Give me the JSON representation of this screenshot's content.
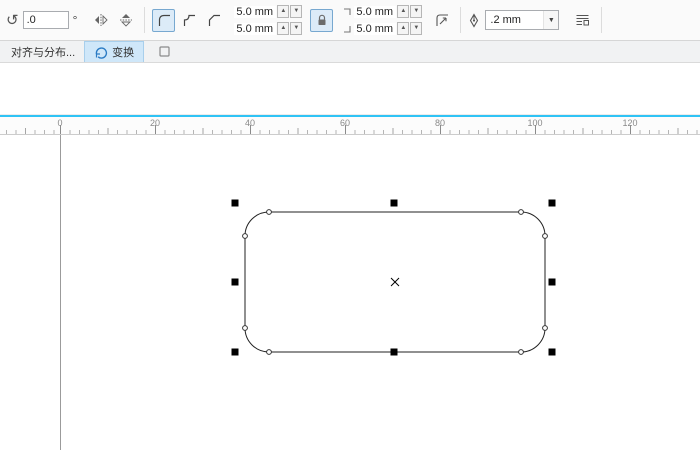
{
  "property_bar": {
    "rotation": {
      "icon_glyph": "↺",
      "value": ".0",
      "degree_symbol": "°"
    },
    "corner_radius": {
      "top_left": "5.0 mm",
      "bottom_left": "5.0 mm",
      "top_right": "5.0 mm",
      "bottom_right": "5.0 mm"
    },
    "outline_width": ".2 mm",
    "glyphs": {
      "spin_up": "▲",
      "spin_down": "▼",
      "dropdown_arrow": "▼"
    }
  },
  "docker_tabs": {
    "align_distribute": "对齐与分布...",
    "transform": "变换"
  },
  "ruler": {
    "unit_labels": [
      "0",
      "20",
      "40",
      "60",
      "80",
      "100",
      "120"
    ]
  },
  "canvas": {
    "object_type": "rounded-rectangle"
  },
  "colors": {
    "ruler_accent": "#2fc3f5",
    "active_tab_bg": "#cfe7f9",
    "selection": "#000000"
  }
}
